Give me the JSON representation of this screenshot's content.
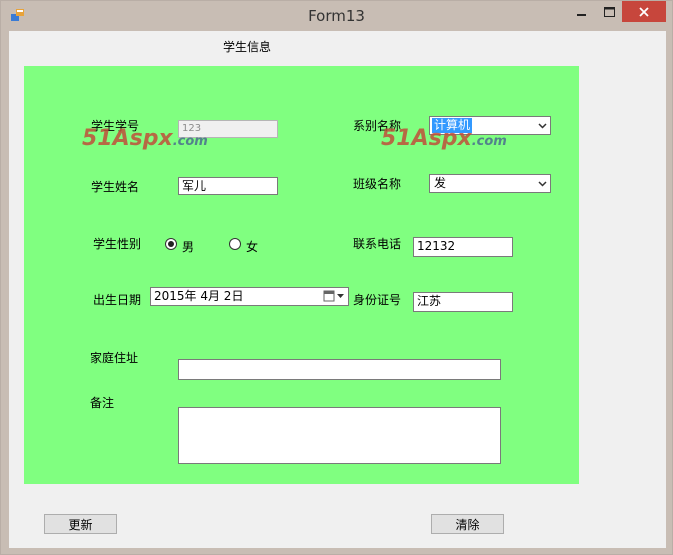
{
  "window": {
    "title": "Form13"
  },
  "form": {
    "heading": "学生信息",
    "labels": {
      "student_id": "学生学号",
      "student_name": "学生姓名",
      "gender": "学生性别",
      "birth_date": "出生日期",
      "address": "家庭住址",
      "notes": "备注",
      "department": "系别名称",
      "class_name": "班级名称",
      "phone": "联系电话",
      "id_number": "身份证号"
    },
    "values": {
      "student_id": "123",
      "student_name": "军儿",
      "department": "计算机",
      "class_name": "发",
      "phone": "12132",
      "id_number": "江苏",
      "birth_date": "2015年 4月 2日",
      "address": "",
      "notes": ""
    },
    "gender_options": {
      "male": "男",
      "female": "女",
      "selected": "男"
    },
    "watermark": {
      "main": "51Aspx",
      "suffix": ".com"
    }
  },
  "buttons": {
    "update": "更新",
    "clear": "清除"
  },
  "colors": {
    "panel": "#80ff80",
    "titlebar": "#c8bdb4",
    "close": "#c7463c"
  }
}
